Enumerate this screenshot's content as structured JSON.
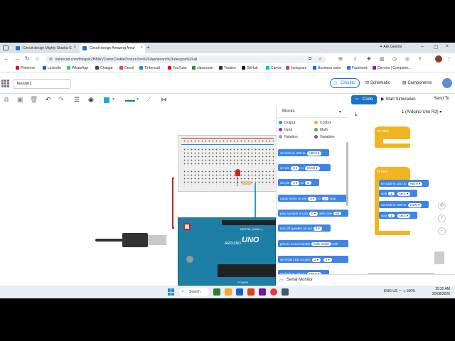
{
  "browser": {
    "tabs": [
      {
        "label": "Circuit design Mighty Stantia-G"
      },
      {
        "label": "Circuit design Amazing Amur"
      }
    ],
    "new_tab": "+",
    "ask_gemini": "Ask Gemini",
    "url": "tinkercad.com/things/kZHBWVCwmzC/editel?returnTo=%2Fdashboard%2Fdesigns%2Fall",
    "bookmarks": [
      {
        "label": "Pinterest",
        "color": "#e60023"
      },
      {
        "label": "LinkedIn",
        "color": "#0a66c2"
      },
      {
        "label": "WhatsApp",
        "color": "#25d366"
      },
      {
        "label": "Chatgpt",
        "color": "#444444"
      },
      {
        "label": "Gmail",
        "color": "#ea4335"
      },
      {
        "label": "Tinkercad",
        "color": "#1e88e5"
      },
      {
        "label": "YouTube",
        "color": "#ff0000"
      },
      {
        "label": "classroom",
        "color": "#1e8e3e"
      },
      {
        "label": "Youbee",
        "color": "#333333"
      },
      {
        "label": "GitHub",
        "color": "#111111"
      },
      {
        "label": "Canva",
        "color": "#00c4cc"
      },
      {
        "label": "Instagram",
        "color": "#c13584"
      },
      {
        "label": "Business suite",
        "color": "#0866ff"
      },
      {
        "label": "Facebook",
        "color": "#1877f2"
      },
      {
        "label": "Devoria | Computer...",
        "color": "#7b1fa2"
      }
    ]
  },
  "tinkercad": {
    "project_name": "lesson1",
    "views": {
      "circuits": "Circuits",
      "schematic": "Schematic",
      "components": "Components"
    },
    "code_button": "Code",
    "start_simulation": "Start Simulation",
    "send_to": "Send To",
    "accent": "#1a73c8"
  },
  "breadboard": {
    "uno_label": "UNO",
    "arduino_label": "ARDUINO",
    "digital_label": "DIGITAL (PWM~)",
    "power_label": "POWER"
  },
  "blocks_panel": {
    "dropdown": "Blocks",
    "categories": [
      {
        "label": "Output",
        "color": "#3d85e6"
      },
      {
        "label": "Control",
        "color": "#f2b521"
      },
      {
        "label": "Input",
        "color": "#9c27b0"
      },
      {
        "label": "Math",
        "color": "#4caf50"
      },
      {
        "label": "Notation",
        "color": "#9e9e9e"
      },
      {
        "label": "Variables",
        "color": "#8e44ad"
      }
    ],
    "blocks": [
      {
        "parts": [
          "set built-in LED to",
          "HIGH ▾"
        ]
      },
      {
        "parts": [
          "set pin",
          "0 ▾",
          "to",
          "HIGH ▾"
        ]
      },
      {
        "parts": [
          "set pin",
          "3 ▾",
          "to",
          "0"
        ]
      },
      {
        "parts": [
          "rotate servo on pin",
          "0 ▾",
          "to",
          "0",
          "degr"
        ]
      },
      {
        "parts": [
          "play speaker on pin",
          "0 ▾",
          "with tone",
          "60"
        ]
      },
      {
        "parts": [
          "turn off speaker on pin",
          "0 ▾"
        ]
      },
      {
        "parts": [
          "print to serial monitor",
          "hello world",
          "with"
        ]
      },
      {
        "parts": [
          "set RGB LED on pins",
          "3 ▾",
          "5 ▾"
        ]
      },
      {
        "parts": [
          "set built-in LED to",
          "HIGH ▾"
        ]
      }
    ]
  },
  "workspace": {
    "board": "1 (Arduino Uno R3)",
    "on_start": "on start",
    "forever": "forever",
    "program": [
      {
        "parts": [
          "set built-in LED to",
          "HIGH ▾"
        ]
      },
      {
        "parts": [
          "wait",
          "1",
          "secs ▾"
        ]
      },
      {
        "parts": [
          "set built-in LED to",
          "LOW ▾"
        ]
      },
      {
        "parts": [
          "wait",
          "1",
          "secs ▾"
        ]
      }
    ],
    "serial_monitor": "Serial Monitor"
  },
  "taskbar": {
    "search": "Search",
    "tray": "ENG US",
    "battery": "100%",
    "time": "10:20 AM",
    "date": "20/08/2026"
  }
}
